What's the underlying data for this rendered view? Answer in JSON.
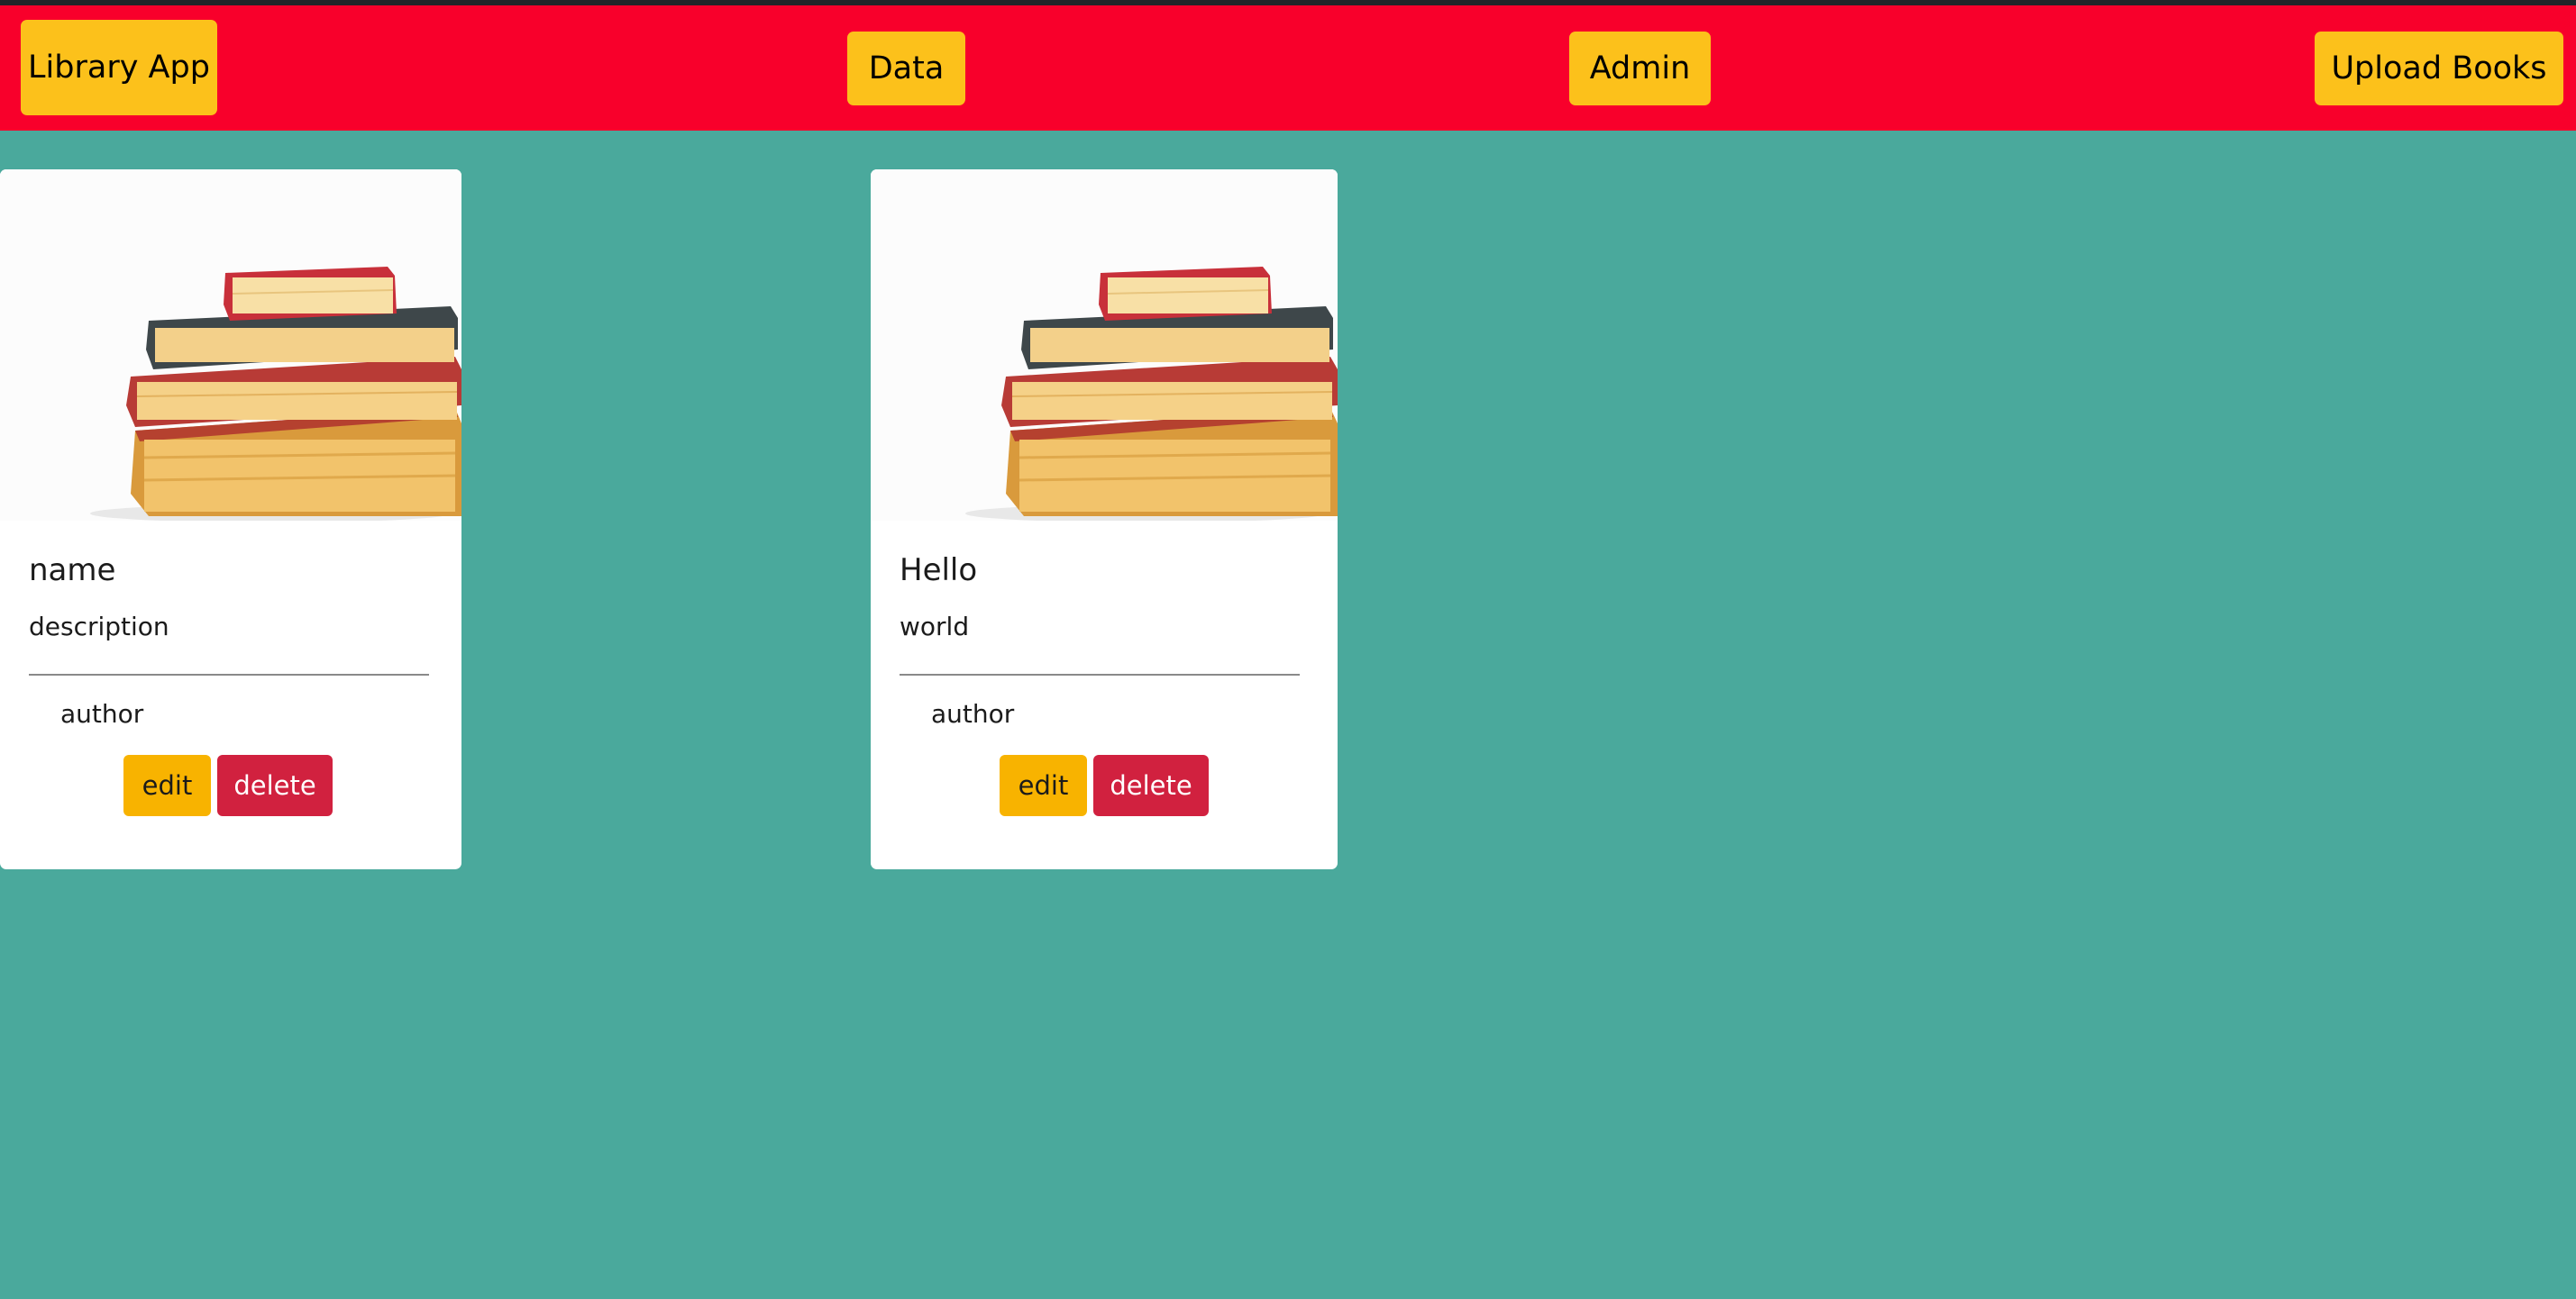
{
  "navbar": {
    "brand": "Library App",
    "links": [
      "Data",
      "Admin",
      "Upload Books"
    ]
  },
  "books": [
    {
      "name": "name",
      "description": "description",
      "author": "author",
      "edit_label": "edit",
      "delete_label": "delete"
    },
    {
      "name": "Hello",
      "description": "world",
      "author": "author",
      "edit_label": "edit",
      "delete_label": "delete"
    }
  ],
  "colors": {
    "navbar": "#f8002b",
    "page_background": "#4aa99c",
    "nav_button": "#fcc11b",
    "edit_button": "#f8b300",
    "delete_button": "#d1213f"
  },
  "icons": {
    "card_image": "stack-of-books-image"
  }
}
